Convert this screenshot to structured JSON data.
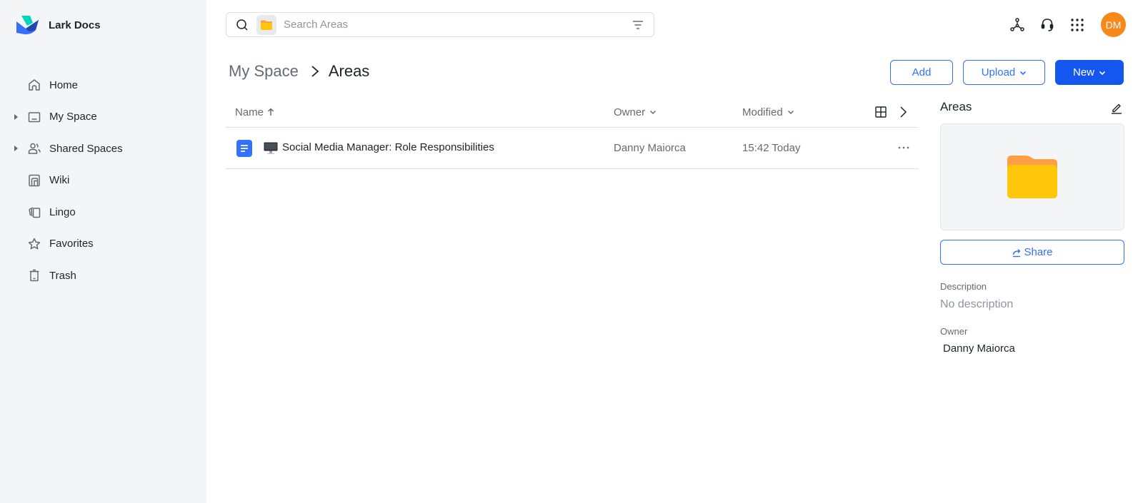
{
  "app": {
    "name": "Lark Docs",
    "brand_colors": {
      "primary": "#1456f0",
      "accent": "#3370ff",
      "avatar": "#f7881a",
      "folder": "#ffc60a",
      "folder_tab": "#ff9f45",
      "doc": "#3370ff"
    }
  },
  "sidebar": {
    "items": [
      {
        "label": "Home",
        "icon": "home-icon",
        "expandable": false
      },
      {
        "label": "My Space",
        "icon": "folder-icon",
        "expandable": true
      },
      {
        "label": "Shared Spaces",
        "icon": "users-icon",
        "expandable": true
      },
      {
        "label": "Wiki",
        "icon": "wiki-icon",
        "expandable": false
      },
      {
        "label": "Lingo",
        "icon": "lingo-cards-icon",
        "expandable": false
      },
      {
        "label": "Favorites",
        "icon": "star-icon",
        "expandable": false
      },
      {
        "label": "Trash",
        "icon": "trash-icon",
        "expandable": false
      }
    ]
  },
  "search": {
    "placeholder": "Search Areas",
    "value": "",
    "scope_icon": "folder-icon"
  },
  "topbar": {
    "icons": [
      "org-chart-icon",
      "headset-icon",
      "apps-grid-icon"
    ],
    "avatar_initials": "DM"
  },
  "breadcrumb": {
    "parent": "My Space",
    "current": "Areas"
  },
  "actions": {
    "add_label": "Add",
    "upload_label": "Upload",
    "new_label": "New"
  },
  "table": {
    "columns": {
      "name": "Name",
      "owner": "Owner",
      "modified": "Modified"
    },
    "sort": {
      "column": "Name",
      "direction": "ascending"
    },
    "rows": [
      {
        "name": "Social Media Manager: Role Responsibilities",
        "type_icon": "doc-icon",
        "emoji": "desktop-computer-icon",
        "owner": "Danny Maiorca",
        "modified": "15:42 Today"
      }
    ]
  },
  "panel": {
    "title": "Areas",
    "share_label": "Share",
    "description_label": "Description",
    "description_value": "No description",
    "owner_label": "Owner",
    "owner_value": "Danny Maiorca"
  }
}
